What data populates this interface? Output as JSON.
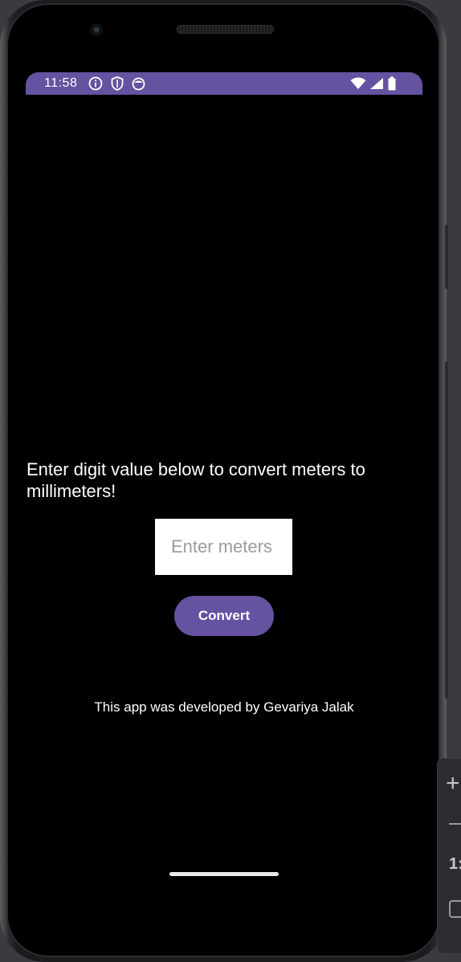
{
  "status_bar": {
    "time": "11:58",
    "left_icons": [
      "info-icon",
      "shield-icon",
      "face-icon"
    ],
    "right_icons": [
      "wifi-icon",
      "signal-icon",
      "battery-icon"
    ],
    "color": "#6552a0"
  },
  "main": {
    "headline": "Enter digit value below to convert meters to millimeters!",
    "input": {
      "placeholder": "Enter meters",
      "value": ""
    },
    "convert_label": "Convert",
    "credit": "This app was developed by Gevariya Jalak"
  },
  "emulator_toolbar": {
    "ratio_label": "1:"
  },
  "colors": {
    "accent": "#6552a0",
    "background": "#000000"
  }
}
